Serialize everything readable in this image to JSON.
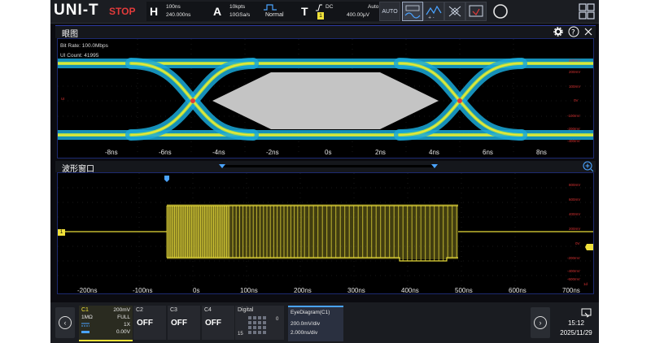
{
  "topbar": {
    "logo": "UNI-T",
    "status": "STOP",
    "horizontal": {
      "letter": "H",
      "scale": "100ns",
      "delay": "240.000ns"
    },
    "acquire": {
      "letter": "A",
      "points": "10kpts",
      "rate": "10GSa/s",
      "mode": "Normal"
    },
    "trigger": {
      "letter": "T",
      "coupling": "DC",
      "mode": "Auto",
      "source": "1",
      "level": "400.00μV"
    },
    "auto_label": "AUTO"
  },
  "eye_panel": {
    "title": "眼图",
    "bit_rate": "Bit Rate: 100.0Mbps",
    "ui_count": "UI Count: 41995",
    "left_marker": "UI",
    "x_ticks": [
      "-8ns",
      "-6ns",
      "-4ns",
      "-2ns",
      "0s",
      "2ns",
      "4ns",
      "6ns",
      "8ns"
    ],
    "y_ticks": [
      "400mV",
      "200mV",
      "100mV",
      "0V",
      "-100mV",
      "-200mV",
      "-400mV"
    ]
  },
  "wave_panel": {
    "title": "波形窗口",
    "x_ticks": [
      "-200ns",
      "-100ns",
      "0s",
      "100ns",
      "200ns",
      "300ns",
      "400ns",
      "500ns",
      "600ns",
      "700ns"
    ],
    "y_ticks": [
      "800mV",
      "600mV",
      "400mV",
      "200mV",
      "0V",
      "-200mV",
      "-400mV",
      "-600mV",
      "1d"
    ],
    "channel_marker": "1"
  },
  "bottombar": {
    "c1": {
      "name": "C1",
      "scale": "200mV",
      "impedance": "1MΩ",
      "bandwidth": "FULL",
      "probe": "1X",
      "offset": "0.00V"
    },
    "c2": {
      "name": "C2",
      "state": "OFF"
    },
    "c3": {
      "name": "C3",
      "state": "OFF"
    },
    "c4": {
      "name": "C4",
      "state": "OFF"
    },
    "digital": {
      "name": "Digital",
      "low": "0",
      "high": "15"
    },
    "eye": {
      "name": "EyeDiagram(C1)",
      "vscale": "200.0mV/div",
      "hscale": "2.000ns/div"
    },
    "time": "15:12",
    "date": "2025/11/29"
  }
}
